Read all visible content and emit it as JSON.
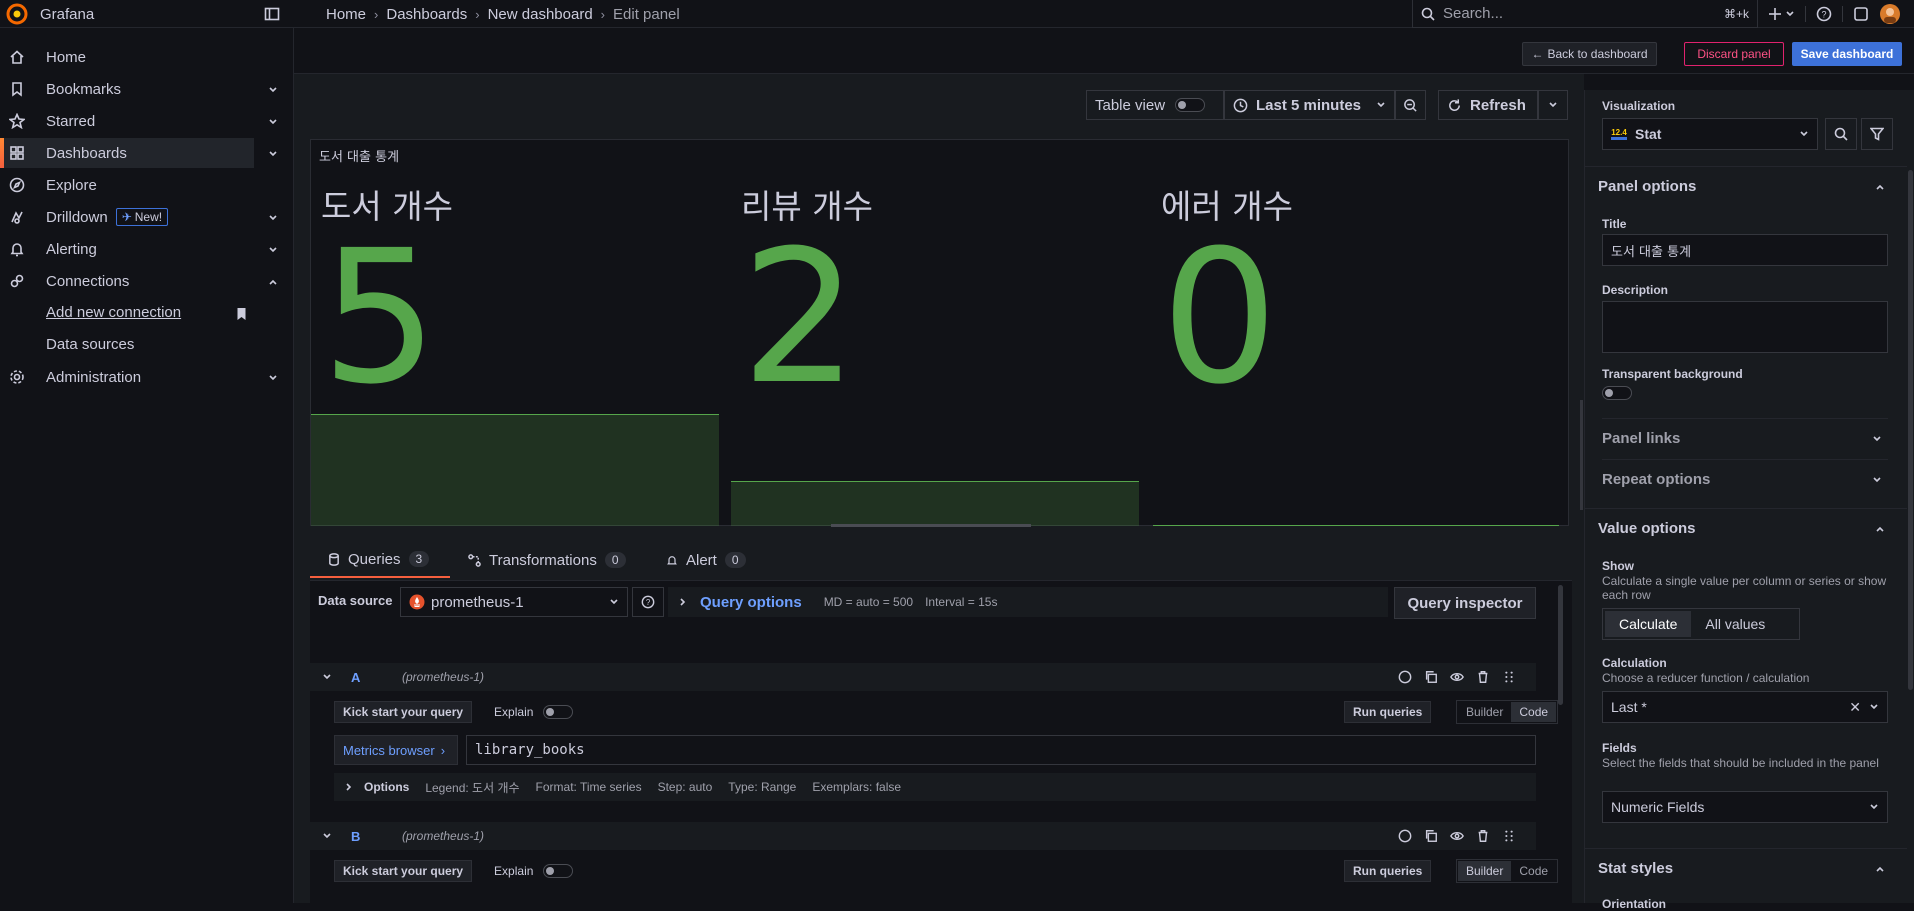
{
  "app": {
    "name": "Grafana"
  },
  "breadcrumb": [
    "Home",
    "Dashboards",
    "New dashboard",
    "Edit panel"
  ],
  "search": {
    "placeholder": "Search...",
    "shortcut": "⌘+k"
  },
  "sidebar": {
    "items": [
      {
        "label": "Home",
        "icon": "home-icon"
      },
      {
        "label": "Bookmarks",
        "icon": "bookmark-icon"
      },
      {
        "label": "Starred",
        "icon": "star-icon"
      },
      {
        "label": "Dashboards",
        "icon": "apps-icon"
      },
      {
        "label": "Explore",
        "icon": "compass-icon"
      },
      {
        "label": "Drilldown",
        "icon": "drilldown-icon",
        "badge": "New!"
      },
      {
        "label": "Alerting",
        "icon": "bell-icon"
      },
      {
        "label": "Connections",
        "icon": "link-icon"
      },
      {
        "label": "Administration",
        "icon": "gear-icon"
      }
    ],
    "connections_children": [
      "Add new connection",
      "Data sources"
    ]
  },
  "actions": {
    "back": "Back to dashboard",
    "discard": "Discard panel",
    "save": "Save dashboard"
  },
  "controls": {
    "table_view": "Table view",
    "time_range": "Last 5 minutes",
    "refresh": "Refresh"
  },
  "panel": {
    "title": "도서 대출 통계",
    "stats": [
      {
        "label": "도서 개수",
        "value": "5",
        "spark_level": 0.55
      },
      {
        "label": "리뷰 개수",
        "value": "2",
        "spark_level": 0.22
      },
      {
        "label": "에러 개수",
        "value": "0",
        "spark_level": 0.0
      }
    ]
  },
  "tabs": [
    {
      "label": "Queries",
      "count": "3",
      "icon": "database-icon"
    },
    {
      "label": "Transformations",
      "count": "0",
      "icon": "transform-icon"
    },
    {
      "label": "Alert",
      "count": "0",
      "icon": "bell-icon"
    }
  ],
  "query_bar": {
    "data_source_label": "Data source",
    "data_source": "prometheus-1",
    "query_options": "Query options",
    "md": "MD = auto = 500",
    "interval": "Interval = 15s",
    "inspector": "Query inspector"
  },
  "queries": [
    {
      "ref": "A",
      "source": "(prometheus-1)",
      "kick_start": "Kick start your query",
      "explain": "Explain",
      "run": "Run queries",
      "builder": "Builder",
      "code": "Code",
      "mode": "Code",
      "metrics_browser": "Metrics browser",
      "expr": "library_books",
      "options": {
        "title": "Options",
        "legend": "Legend: 도서 개수",
        "format": "Format: Time series",
        "step": "Step: auto",
        "type": "Type: Range",
        "exemplars": "Exemplars: false"
      }
    },
    {
      "ref": "B",
      "source": "(prometheus-1)",
      "kick_start": "Kick start your query",
      "explain": "Explain",
      "run": "Run queries",
      "builder": "Builder",
      "code": "Code",
      "mode": "Builder"
    }
  ],
  "options_pane": {
    "visualization_label": "Visualization",
    "visualization": "Stat",
    "visualization_icon_text": "12.4",
    "panel_options": "Panel options",
    "title_label": "Title",
    "title_value": "도서 대출 통계",
    "description_label": "Description",
    "transparent_label": "Transparent background",
    "panel_links": "Panel links",
    "repeat_options": "Repeat options",
    "value_options": "Value options",
    "show_label": "Show",
    "show_desc": "Calculate a single value per column or series or show each row",
    "show_calculate": "Calculate",
    "show_all": "All values",
    "calc_label": "Calculation",
    "calc_desc": "Choose a reducer function / calculation",
    "calc_value": "Last *",
    "fields_label": "Fields",
    "fields_desc": "Select the fields that should be included in the panel",
    "fields_value": "Numeric Fields",
    "stat_styles": "Stat styles",
    "orientation_label": "Orientation"
  },
  "colors": {
    "accent": "#3d71d9",
    "stat_green": "#56a64b",
    "discard": "#e0226e",
    "active_bar": "#f55f3e"
  }
}
